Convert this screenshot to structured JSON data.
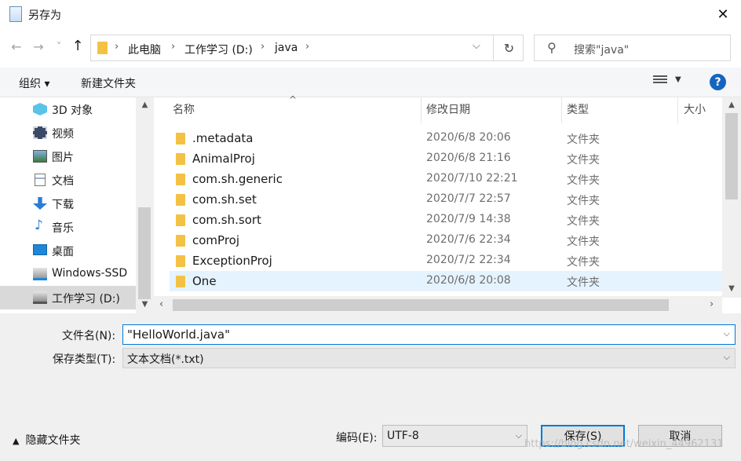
{
  "window": {
    "title": "另存为",
    "close_label": "✕"
  },
  "nav": {
    "back": "←",
    "forward": "→",
    "recent": "˅",
    "up": "↑",
    "breadcrumbs": [
      "此电脑",
      "工作学习 (D:)",
      "java"
    ],
    "refresh": "↻",
    "search_placeholder": "搜索\"java\""
  },
  "toolbar": {
    "organize": "组织 ▾",
    "new_folder": "新建文件夹",
    "help": "?"
  },
  "sidebar": {
    "items": [
      {
        "label": "3D 对象",
        "icon": "cube-3d-icon"
      },
      {
        "label": "视频",
        "icon": "video-icon"
      },
      {
        "label": "图片",
        "icon": "picture-icon"
      },
      {
        "label": "文档",
        "icon": "document-icon"
      },
      {
        "label": "下载",
        "icon": "download-arrow-icon"
      },
      {
        "label": "音乐",
        "icon": "music-note-icon"
      },
      {
        "label": "桌面",
        "icon": "desktop-icon"
      },
      {
        "label": "Windows-SSD",
        "icon": "windows-drive-icon"
      },
      {
        "label": "工作学习 (D:)",
        "icon": "drive-icon",
        "selected": true
      }
    ]
  },
  "columns": {
    "name": "名称",
    "modified": "修改日期",
    "type": "类型",
    "size": "大小"
  },
  "files": [
    {
      "name": ".metadata",
      "modified": "2020/6/8 20:06",
      "type": "文件夹"
    },
    {
      "name": "AnimalProj",
      "modified": "2020/6/8 21:16",
      "type": "文件夹"
    },
    {
      "name": "com.sh.generic",
      "modified": "2020/7/10 22:21",
      "type": "文件夹"
    },
    {
      "name": "com.sh.set",
      "modified": "2020/7/7 22:57",
      "type": "文件夹"
    },
    {
      "name": "com.sh.sort",
      "modified": "2020/7/9 14:38",
      "type": "文件夹"
    },
    {
      "name": "comProj",
      "modified": "2020/7/6 22:34",
      "type": "文件夹"
    },
    {
      "name": "ExceptionProj",
      "modified": "2020/7/2 22:34",
      "type": "文件夹"
    },
    {
      "name": "One",
      "modified": "2020/6/8 20:08",
      "type": "文件夹",
      "selected": true
    }
  ],
  "form": {
    "filename_label": "文件名(N):",
    "filename_value": "\"HelloWorld.java\"",
    "filetype_label": "保存类型(T):",
    "filetype_value": "文本文档(*.txt)"
  },
  "footer": {
    "hide_folders": "隐藏文件夹",
    "encoding_label": "编码(E):",
    "encoding_value": "UTF-8",
    "save": "保存(S)",
    "cancel": "取消"
  },
  "watermark": "https://blog.csdn.net/weixin_44962131"
}
